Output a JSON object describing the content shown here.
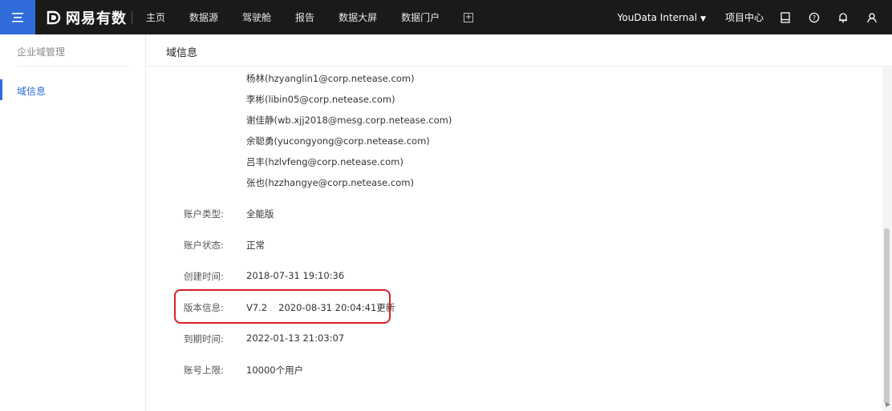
{
  "topbar": {
    "menu_icon": "menu-icon",
    "logo_mark": "ᗪ",
    "logo_text": "网易有数",
    "nav": [
      "主页",
      "数据源",
      "驾驶舱",
      "报告",
      "数据大屏",
      "数据门户"
    ],
    "nav_plus": "+",
    "org_name": "YouData Internal",
    "project_center": "项目中心",
    "icons": [
      "document-icon",
      "help-icon",
      "bell-icon",
      "user-icon"
    ]
  },
  "sidebar": {
    "title": "企业域管理",
    "active_item": "域信息"
  },
  "page": {
    "title": "域信息"
  },
  "members": [
    "杨林(hzyanglin1@corp.netease.com)",
    "李彬(libin05@corp.netease.com)",
    "谢佳静(wb.xjj2018@mesg.corp.netease.com)",
    "余聪勇(yucongyong@corp.netease.com)",
    "吕丰(hzlvfeng@corp.netease.com)",
    "张也(hzzhangye@corp.netease.com)"
  ],
  "info": {
    "account_type_label": "账户类型:",
    "account_type": "全能版",
    "account_status_label": "账户状态:",
    "account_status": "正常",
    "created_label": "创建时间:",
    "created": "2018-07-31 19:10:36",
    "version_label": "版本信息:",
    "version": "V7.2",
    "version_updated": "2020-08-31 20:04:41更新",
    "expire_label": "到期时间:",
    "expire": "2022-01-13 21:03:07",
    "limit_label": "账号上限:",
    "limit": "10000个用户"
  },
  "colors": {
    "accent": "#2f6bd9",
    "topbar_bg": "#1a1a1a",
    "highlight": "#d6202a"
  }
}
